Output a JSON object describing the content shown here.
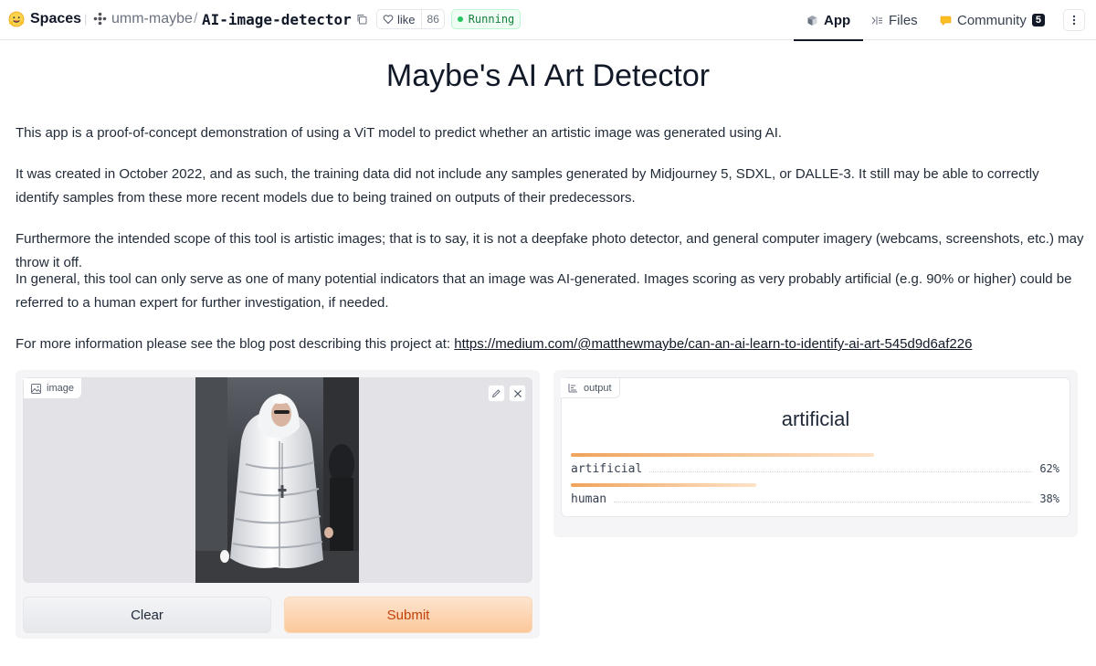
{
  "header": {
    "spaces_label": "Spaces",
    "owner": "umm-maybe",
    "slash": "/",
    "repo": "AI-image-detector",
    "like_label": "like",
    "like_count": "86",
    "status": "Running",
    "tabs": [
      {
        "label": "App",
        "icon": "cube-icon"
      },
      {
        "label": "Files",
        "icon": "files-icon"
      },
      {
        "label": "Community",
        "icon": "community-icon",
        "count": "5"
      }
    ]
  },
  "main": {
    "title": "Maybe's AI Art Detector",
    "paragraphs": [
      "This app is a proof-of-concept demonstration of using a ViT model to predict whether an artistic image was generated using AI.",
      "It was created in October 2022, and as such, the training data did not include any samples generated by Midjourney 5, SDXL, or DALLE-3. It still may be able to correctly identify samples from these more recent models due to being trained on outputs of their predecessors.",
      "Furthermore the intended scope of this tool is artistic images; that is to say, it is not a deepfake photo detector, and general computer imagery (webcams, screenshots, etc.) may throw it off.",
      "In general, this tool can only serve as one of many potential indicators that an image was AI-generated. Images scoring as very probably artificial (e.g. 90% or higher) could be referred to a human expert for further investigation, if needed."
    ],
    "more_info_prefix": "For more information please see the blog post describing this project at: ",
    "more_info_link": "https://medium.com/@matthewmaybe/can-an-ai-learn-to-identify-ai-art-545d9d6af226"
  },
  "input_panel": {
    "image_label": "image",
    "clear_label": "Clear",
    "submit_label": "Submit"
  },
  "output_panel": {
    "label": "output",
    "predicted": "artificial",
    "confidences": [
      {
        "label": "artificial",
        "percent": "62%",
        "value": 0.62
      },
      {
        "label": "human",
        "percent": "38%",
        "value": 0.38
      }
    ]
  },
  "colors": {
    "accent_orange": "#f0a35c",
    "submit_text": "#c2410c",
    "status_green": "#22c55e"
  }
}
